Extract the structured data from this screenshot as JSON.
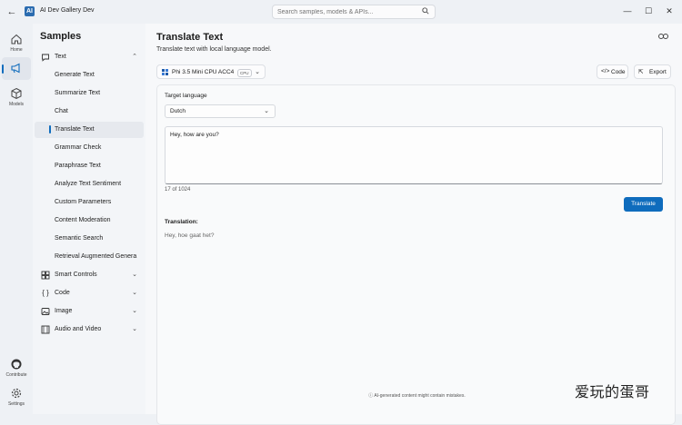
{
  "titlebar": {
    "app_title": "AI Dev Gallery Dev",
    "app_logo_text": "AI",
    "search_placeholder": "Search samples, models & APIs...",
    "minimize": "—",
    "maximize": "☐",
    "close": "✕"
  },
  "rail": {
    "home_label": "Home",
    "samples_label": "",
    "models_label": "Models",
    "contribute_label": "Contribute",
    "settings_label": "Settings"
  },
  "sidebar": {
    "title": "Samples",
    "groups": [
      {
        "label": "Text",
        "icon": "chat-icon",
        "expanded": true
      },
      {
        "label": "Smart Controls",
        "icon": "grid-icon",
        "expanded": false
      },
      {
        "label": "Code",
        "icon": "braces-icon",
        "expanded": false
      },
      {
        "label": "Image",
        "icon": "image-icon",
        "expanded": false
      },
      {
        "label": "Audio and Video",
        "icon": "media-icon",
        "expanded": false
      }
    ],
    "text_items": [
      "Generate Text",
      "Summarize Text",
      "Chat",
      "Translate Text",
      "Grammar Check",
      "Paraphrase Text",
      "Analyze Text Sentiment",
      "Custom Parameters",
      "Content Moderation",
      "Semantic Search",
      "Retrieval Augmented Genera"
    ],
    "active_item": "Translate Text"
  },
  "main": {
    "title": "Translate Text",
    "subtitle": "Translate text with local language model.",
    "model": {
      "name": "Phi 3.5 Mini CPU ACC4",
      "badge": "CPU"
    },
    "code_button": "Code",
    "export_button": "Export",
    "target_language_label": "Target language",
    "target_language_value": "Dutch",
    "input_text": "Hey, how are you?",
    "char_count": "17 of 1024",
    "translate_button": "Translate",
    "translation_label": "Translation:",
    "translation_result": "Hey, hoe gaat het?",
    "disclaimer": "AI-generated content might contain mistakes."
  },
  "watermark": "爱玩的蛋哥",
  "colors": {
    "accent": "#0f6cbd",
    "background": "#eef1f5",
    "panel": "#f9fafb"
  }
}
